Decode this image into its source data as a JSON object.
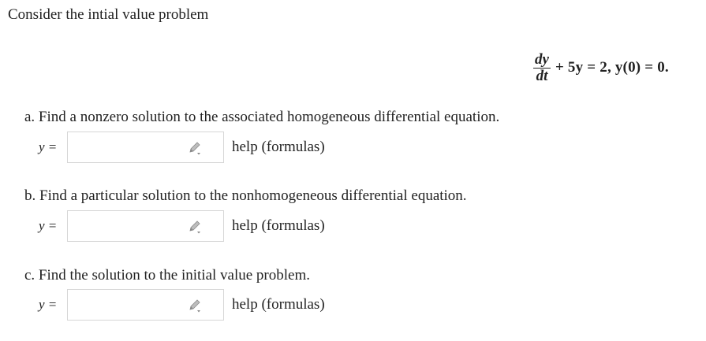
{
  "intro": "Consider the intial value problem",
  "equation": {
    "numerator": "dy",
    "denominator": "dt",
    "rest": "+ 5y = 2,   y(0) = 0."
  },
  "parts": [
    {
      "prompt": "a. Find a nonzero solution to the associated homogeneous differential equation.",
      "label": "y =",
      "value": "",
      "help": "help (formulas)",
      "icon": "pencil-icon"
    },
    {
      "prompt": "b. Find a particular solution to the nonhomogeneous differential equation.",
      "label": "y =",
      "value": "",
      "help": "help (formulas)",
      "icon": "pencil-icon"
    },
    {
      "prompt": "c. Find the solution to the initial value problem.",
      "label": "y =",
      "value": "",
      "help": "help (formulas)",
      "icon": "pencil-icon"
    }
  ]
}
